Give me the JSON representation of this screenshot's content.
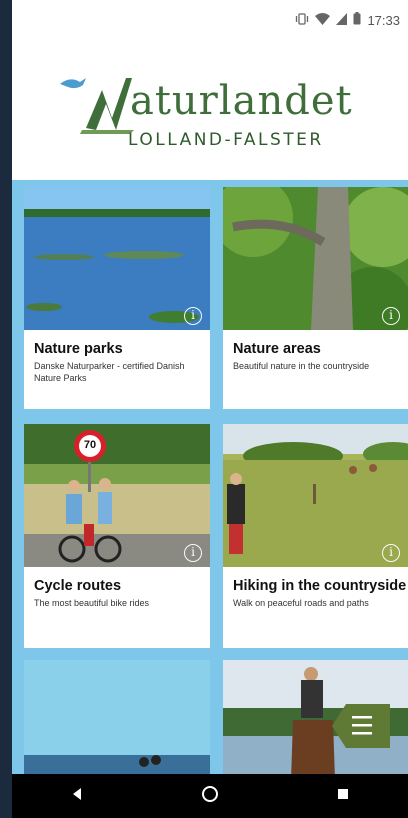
{
  "status": {
    "time": "17:33"
  },
  "logo": {
    "name_rest": "aturlandet",
    "name_initial": "N",
    "subtitle": "LOLLAND-FALSTER"
  },
  "cards": [
    {
      "title": "Nature parks",
      "desc": "Danske Naturparker - certified Danish Nature Parks"
    },
    {
      "title": "Nature areas",
      "desc": "Beautiful nature in the countryside"
    },
    {
      "title": "Cycle routes",
      "desc": "The most beautiful bike rides"
    },
    {
      "title": "Hiking in the countryside",
      "desc": "Walk on peaceful roads and paths"
    }
  ],
  "sign": {
    "speed": "70"
  },
  "colors": {
    "accent_blue": "#7ec6ea",
    "brand_green": "#3f6e3a",
    "menu_green": "#5e7a35"
  },
  "icons": [
    "vibrate-icon",
    "wifi-icon",
    "signal-icon",
    "battery-icon",
    "info-icon",
    "menu-icon",
    "back-icon",
    "home-icon",
    "recents-icon"
  ]
}
